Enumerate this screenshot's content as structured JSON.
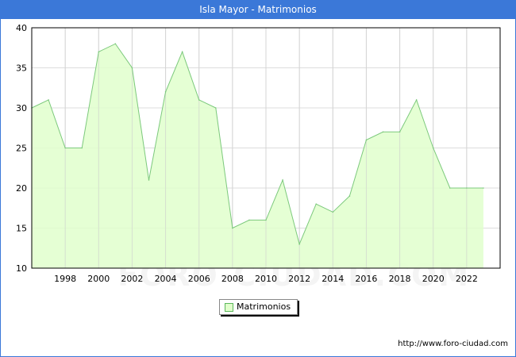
{
  "header": {
    "title": "Isla Mayor - Matrimonios"
  },
  "watermark": "FORO-CIUDAD.COM",
  "footer": {
    "url": "http://www.foro-ciudad.com"
  },
  "colors": {
    "title_bar": "#3b78d8",
    "area_fill": "#e1ffcc",
    "line": "#7cc97c",
    "grid": "#dddddd"
  },
  "chart_data": {
    "type": "area",
    "title": "Isla Mayor - Matrimonios",
    "xlabel": "",
    "ylabel": "",
    "x": [
      1996,
      1997,
      1998,
      1999,
      2000,
      2001,
      2002,
      2003,
      2004,
      2005,
      2006,
      2007,
      2008,
      2009,
      2010,
      2011,
      2012,
      2013,
      2014,
      2015,
      2016,
      2017,
      2018,
      2019,
      2020,
      2021,
      2022,
      2023
    ],
    "series": [
      {
        "name": "Matrimonios",
        "values": [
          30,
          31,
          25,
          25,
          37,
          38,
          35,
          21,
          32,
          37,
          31,
          30,
          15,
          16,
          16,
          21,
          13,
          18,
          17,
          19,
          26,
          27,
          27,
          31,
          25,
          20,
          20,
          20
        ]
      }
    ],
    "xlim": [
      1996,
      2024
    ],
    "ylim": [
      10,
      40
    ],
    "x_ticks": [
      "1998",
      "2000",
      "2002",
      "2004",
      "2006",
      "2008",
      "2010",
      "2012",
      "2014",
      "2016",
      "2018",
      "2020",
      "2022"
    ],
    "y_ticks": [
      "10",
      "15",
      "20",
      "25",
      "30",
      "35",
      "40"
    ],
    "grid": true,
    "legend_position": "bottom-center",
    "legend": [
      "Matrimonios"
    ]
  }
}
